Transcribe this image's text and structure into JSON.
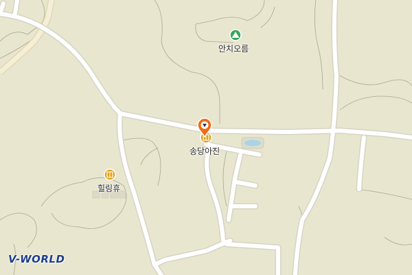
{
  "map": {
    "colors": {
      "land": "#e8e6cf",
      "land_alt": "#ebe9d3",
      "road": "#ffffff",
      "road_edge": "#d6d4c4",
      "major_road": "#f4efd6",
      "major_road_edge": "#e2d8b0",
      "contour": "#a8a793",
      "water": "#a9d3e8",
      "poi_food": "#e0a11c",
      "peak": "#3aa55a",
      "marker": "#f06a14",
      "logo": "#1d3f8a"
    },
    "labels": {
      "peak_name": "안치오름",
      "restaurant_1": "송당아진",
      "restaurant_2": "힐링휴"
    },
    "icons": {
      "peak": "mountain-peak-icon",
      "restaurant": "restaurant-icon",
      "marker": "location-marker-icon"
    },
    "logo": {
      "text": "V-WORLD"
    }
  }
}
